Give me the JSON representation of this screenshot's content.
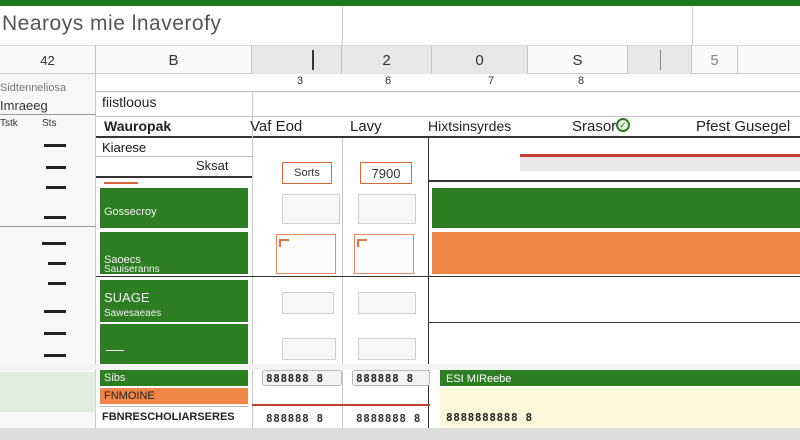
{
  "app": {
    "title": "Nearoys mie lnaverofy"
  },
  "column_headers": {
    "b": "B",
    "c2": "2",
    "c0": "0",
    "s": "S",
    "five": "5"
  },
  "number_row": [
    "3",
    "6",
    "7",
    "8"
  ],
  "sidebar": {
    "top_value": "42",
    "labels": [
      "Sidtenneliosa",
      "Imraeeg",
      "Tstk",
      "Sts"
    ]
  },
  "headers": {
    "group": "fiistloous",
    "col1": "Wauropak",
    "col2": "Vaf Eod",
    "col3": "Lavy",
    "col4": "Hixtsinsyrdes",
    "col5": "Srasor",
    "col6": "Pfest Gusegel"
  },
  "rows": {
    "r1_label": "Kiarese",
    "r2_label": "Sksat",
    "tag1": "Sorts",
    "tag2": "7900",
    "green1_label": "Gossecroy",
    "green2_label": "Saoecs",
    "green2_sub": "Sauiseranns",
    "green3_label": "SUAGE",
    "green3_sub": "Sawesaeaes",
    "orange_label": "FNMOINE",
    "bottom_label": "FBNRESCHOLIARSERES",
    "digits1": "888888 8",
    "digits2": "888888 8",
    "digits3": "888888 8",
    "digits4": "8888888 8",
    "green_bar_text": "ESI MIReebe",
    "digits5": "8888888888 8"
  },
  "colors": {
    "accent_green": "#2d7d22",
    "accent_orange": "#ef8547",
    "accent_red": "#c63c30"
  },
  "icons": [
    "status-check-icon"
  ]
}
